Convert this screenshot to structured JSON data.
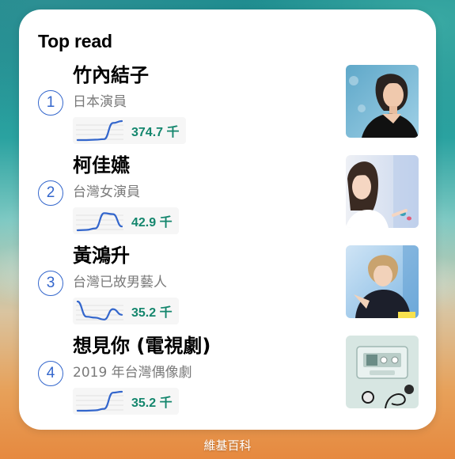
{
  "widget": {
    "title": "Top read",
    "accent_color": "#3366cc",
    "views_color": "#14866d",
    "items": [
      {
        "rank": "1",
        "title": "竹內結子",
        "description": "日本演員",
        "views": "374.7 千",
        "trend": [
          0.0,
          0.0,
          0.02,
          0.05,
          0.9,
          1.0
        ],
        "thumbnail_icon": "portrait-photo"
      },
      {
        "rank": "2",
        "title": "柯佳嬿",
        "description": "台灣女演員",
        "views": "42.9 千",
        "trend": [
          0.0,
          0.02,
          0.1,
          0.9,
          0.85,
          0.2
        ],
        "thumbnail_icon": "portrait-photo"
      },
      {
        "rank": "3",
        "title": "黃鴻升",
        "description": "台灣已故男藝人",
        "views": "35.2 千",
        "trend": [
          1.0,
          0.2,
          0.15,
          0.05,
          0.6,
          0.3
        ],
        "thumbnail_icon": "portrait-photo"
      },
      {
        "rank": "4",
        "title": "想見你 (電視劇)",
        "description": "2019 年台灣偶像劇",
        "views": "35.2 千",
        "trend": [
          0.0,
          0.0,
          0.02,
          0.1,
          0.95,
          1.0
        ],
        "thumbnail_icon": "cassette-tape-photo"
      }
    ]
  },
  "footer": {
    "label": "維基百科"
  }
}
